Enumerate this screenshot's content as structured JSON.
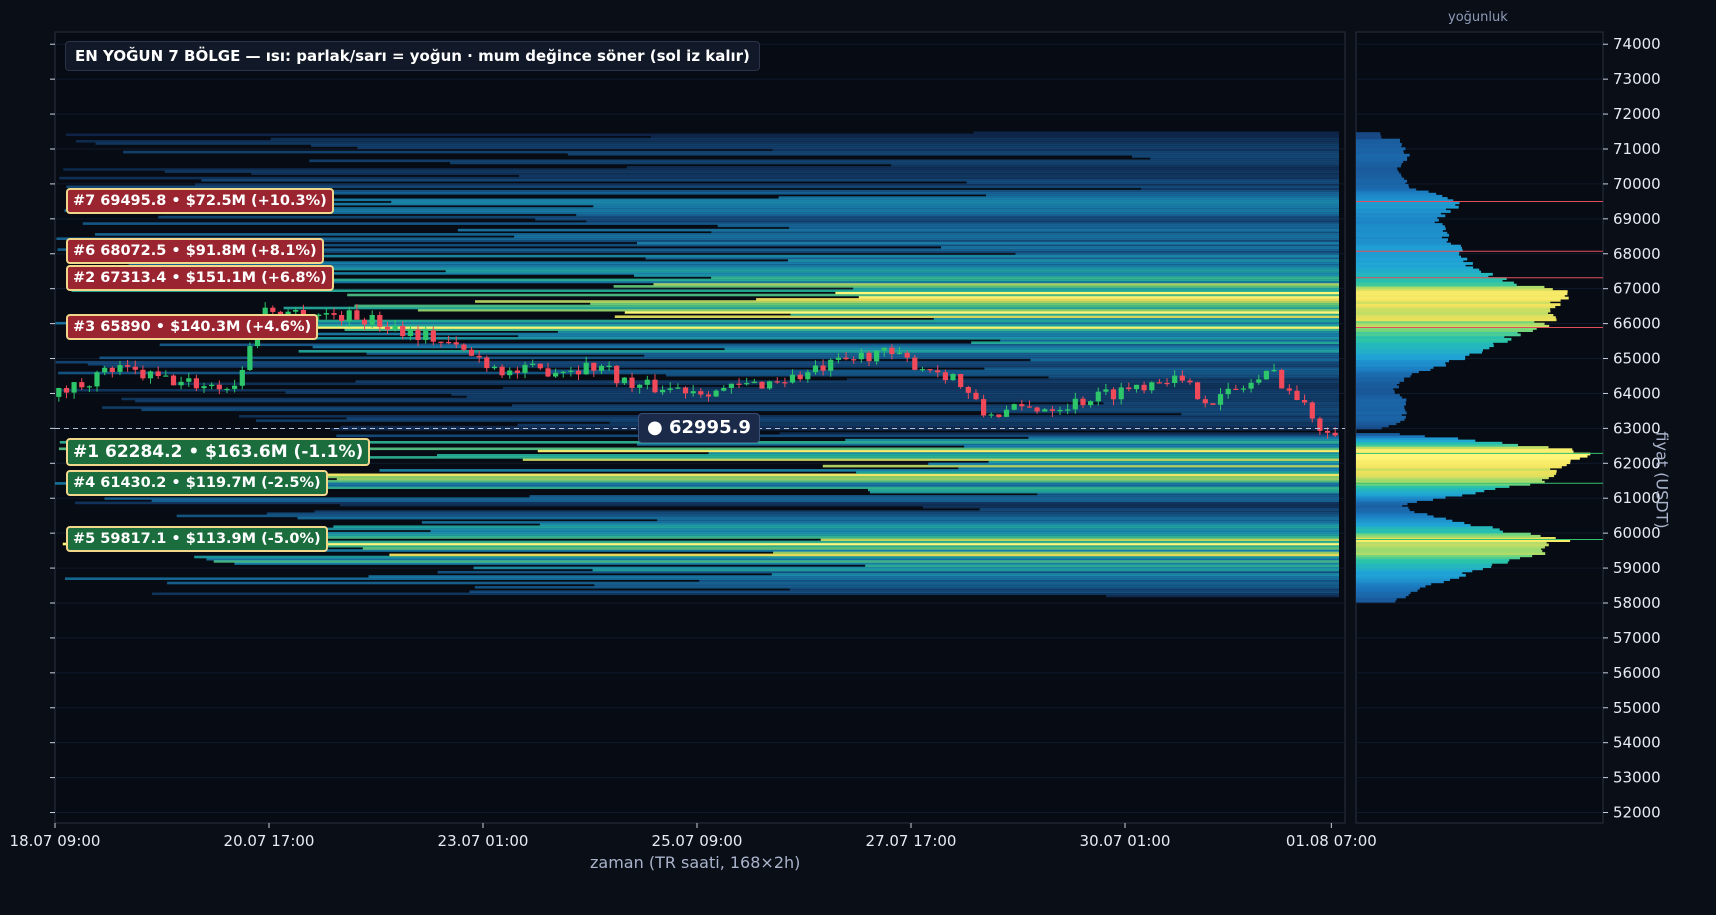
{
  "title": "EN YOĞUN 7 BÖLGE — ısı: parlak/sarı = yoğun · mum değince söner (sol iz kalır)",
  "side_title": "yoğunluk",
  "xlabel": "zaman (TR saati, 168×2h)",
  "ylabel": "fiyat (USDT)",
  "current_price_label": "● 62995.9",
  "colors": {
    "bg": "#0a0e16",
    "plot_bg": "#060b14",
    "up": "#2ec66a",
    "down": "#f04a5a",
    "red_zone": "#9a2530",
    "green_zone": "#1b6d3e",
    "border": "#f0d78c"
  },
  "zones": [
    {
      "text": "#7  69495.8  •  $72.5M  (+10.3%)",
      "price": 69495.8,
      "side": "red",
      "big": false
    },
    {
      "text": "#6  68072.5  •  $91.8M  (+8.1%)",
      "price": 68072.5,
      "side": "red",
      "big": false
    },
    {
      "text": "#2  67313.4  •  $151.1M  (+6.8%)",
      "price": 67313.4,
      "side": "red",
      "big": false
    },
    {
      "text": "#3  65890  •  $140.3M  (+4.6%)",
      "price": 65890,
      "side": "red",
      "big": false
    },
    {
      "text": "#1  62284.2  •  $163.6M  (-1.1%)",
      "price": 62284.2,
      "side": "green",
      "big": true
    },
    {
      "text": "#4  61430.2  •  $119.7M  (-2.5%)",
      "price": 61430.2,
      "side": "green",
      "big": false
    },
    {
      "text": "#5  59817.1  •  $113.9M  (-5.0%)",
      "price": 59817.1,
      "side": "green",
      "big": false
    }
  ],
  "chart_data": {
    "type": "candlestick",
    "x_ticks": [
      "18.07 09:00",
      "20.07 17:00",
      "23.07 01:00",
      "25.07 09:00",
      "27.07 17:00",
      "30.07 01:00",
      "01.08 07:00"
    ],
    "y_ticks": [
      "52000",
      "53000",
      "54000",
      "55000",
      "56000",
      "57000",
      "58000",
      "59000",
      "60000",
      "61000",
      "62000",
      "63000",
      "64000",
      "65000",
      "66000",
      "67000",
      "68000",
      "69000",
      "70000",
      "71000",
      "72000",
      "73000",
      "74000"
    ],
    "ylim": [
      51700,
      74350
    ],
    "current_price": 62995.9,
    "close_path": [
      [
        0,
        63900
      ],
      [
        8,
        64700
      ],
      [
        17,
        64300
      ],
      [
        24,
        64200
      ],
      [
        28,
        66400
      ],
      [
        40,
        66200
      ],
      [
        50,
        65600
      ],
      [
        60,
        64600
      ],
      [
        72,
        64800
      ],
      [
        76,
        64200
      ],
      [
        88,
        64100
      ],
      [
        98,
        64500
      ],
      [
        108,
        65200
      ],
      [
        118,
        64500
      ],
      [
        122,
        63400
      ],
      [
        133,
        63700
      ],
      [
        140,
        64100
      ],
      [
        146,
        64500
      ],
      [
        152,
        63800
      ],
      [
        160,
        64600
      ],
      [
        166,
        63100
      ],
      [
        168,
        63000
      ]
    ],
    "density_profile": [
      [
        58000,
        0.15
      ],
      [
        58500,
        0.3
      ],
      [
        59000,
        0.55
      ],
      [
        59500,
        0.82
      ],
      [
        59800,
        0.87
      ],
      [
        60100,
        0.6
      ],
      [
        60500,
        0.3
      ],
      [
        60800,
        0.18
      ],
      [
        61100,
        0.45
      ],
      [
        61400,
        0.75
      ],
      [
        62000,
        0.88
      ],
      [
        62300,
        1.0
      ],
      [
        62600,
        0.6
      ],
      [
        62900,
        0.05
      ],
      [
        63200,
        0.2
      ],
      [
        63700,
        0.22
      ],
      [
        64100,
        0.16
      ],
      [
        64500,
        0.22
      ],
      [
        65000,
        0.45
      ],
      [
        65500,
        0.62
      ],
      [
        65900,
        0.8
      ],
      [
        66400,
        0.82
      ],
      [
        66900,
        0.88
      ],
      [
        67200,
        0.64
      ],
      [
        67600,
        0.5
      ],
      [
        68100,
        0.45
      ],
      [
        68500,
        0.38
      ],
      [
        69000,
        0.34
      ],
      [
        69500,
        0.45
      ],
      [
        69900,
        0.22
      ],
      [
        70400,
        0.18
      ],
      [
        70800,
        0.22
      ],
      [
        71300,
        0.18
      ]
    ]
  }
}
